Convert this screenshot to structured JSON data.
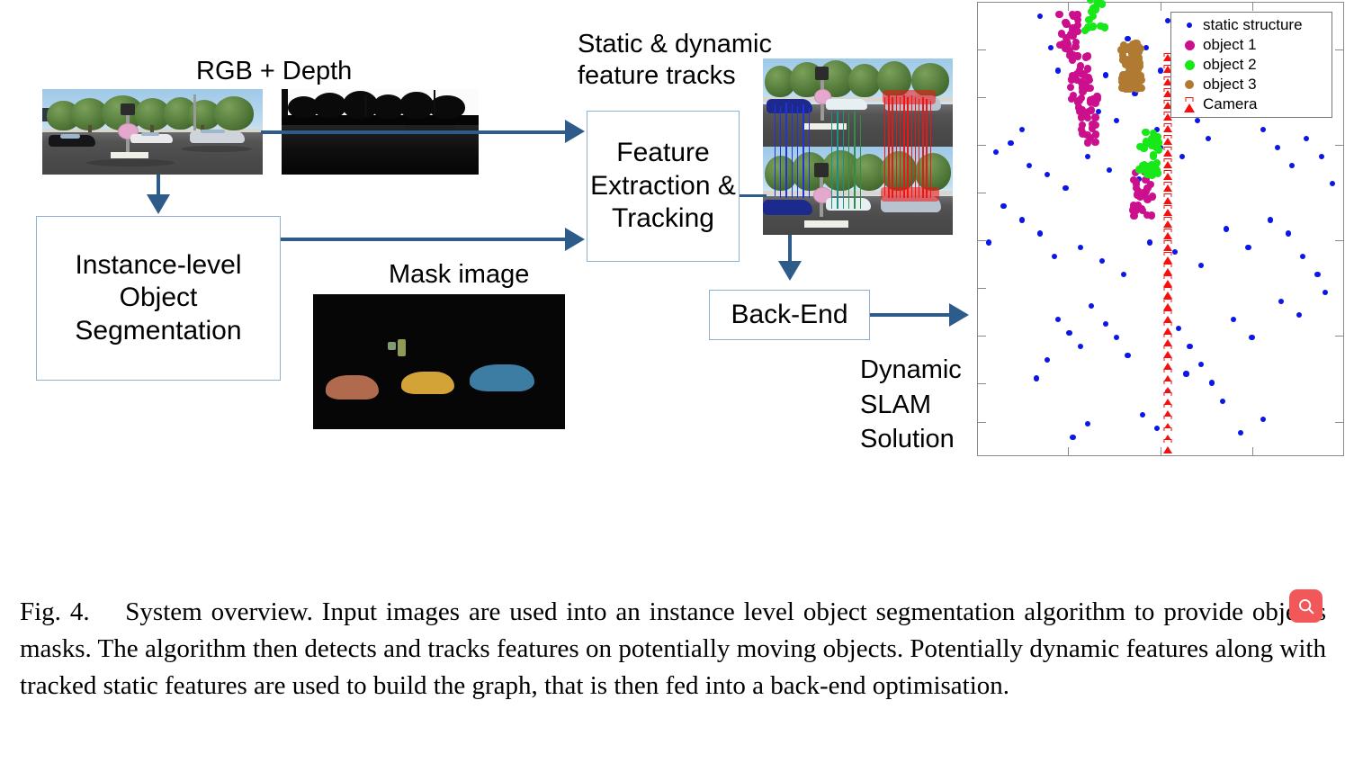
{
  "figure": {
    "labels": {
      "rgb_depth": "RGB + Depth",
      "mask_image": "Mask image",
      "feature_tracks": "Static & dynamic\nfeature tracks",
      "dynamic_slam": "Dynamic\nSLAM\nSolution"
    },
    "boxes": [
      {
        "id": "segmentation",
        "text": "Instance-level\nObject\nSegmentation"
      },
      {
        "id": "feature-extraction",
        "text": "Feature\nExtraction\n& Tracking"
      },
      {
        "id": "back-end",
        "text": "Back-End"
      }
    ],
    "caption": {
      "figure_number": "Fig. 4.",
      "text": "System overview. Input images are used into an instance level object segmentation algorithm to provide objects masks. The algorithm then detects and tracks features on potentially moving objects. Potentially dynamic features along with tracked static features are used to build the graph, that is then fed into a back-end optimisation."
    },
    "colors": {
      "arrow": "#2e5c8a",
      "box_border": "#8fb0cf",
      "static_structure": "#0b16e8",
      "object_1": "#cc0f8c",
      "object_2": "#17e817",
      "object_3": "#b07a33",
      "camera": "#f50f0f",
      "fab": "#f2575a"
    }
  },
  "search_fab": {
    "icon": "search-icon",
    "label": "Search"
  },
  "chart_data": {
    "type": "scatter",
    "title": "Dynamic SLAM Solution",
    "xlabel": "",
    "ylabel": "",
    "grid": false,
    "legend_position": "top-right",
    "legend": [
      {
        "name": "static structure",
        "marker": "dot-small",
        "color": "#0b16e8"
      },
      {
        "name": "object 1",
        "marker": "dot",
        "color": "#cc0f8c"
      },
      {
        "name": "object 2",
        "marker": "dot",
        "color": "#17e817"
      },
      {
        "name": "object 3",
        "marker": "dot",
        "color": "#b07a33"
      },
      {
        "name": "Camera",
        "marker": "camera-frustum",
        "color": "#f50f0f"
      }
    ],
    "axis_ticks": {
      "x_count": 4,
      "y_count": 9,
      "labels_shown": false
    },
    "series": [
      {
        "name": "static structure",
        "color": "#0b16e8",
        "points": [
          [
            0.17,
            0.97
          ],
          [
            0.26,
            0.93
          ],
          [
            0.2,
            0.9
          ],
          [
            0.3,
            0.88
          ],
          [
            0.22,
            0.85
          ],
          [
            0.35,
            0.84
          ],
          [
            0.41,
            0.92
          ],
          [
            0.46,
            0.9
          ],
          [
            0.52,
            0.96
          ],
          [
            0.5,
            0.85
          ],
          [
            0.57,
            0.83
          ],
          [
            0.62,
            0.88
          ],
          [
            0.27,
            0.78
          ],
          [
            0.33,
            0.76
          ],
          [
            0.38,
            0.74
          ],
          [
            0.43,
            0.8
          ],
          [
            0.55,
            0.77
          ],
          [
            0.49,
            0.72
          ],
          [
            0.6,
            0.74
          ],
          [
            0.66,
            0.8
          ],
          [
            0.7,
            0.78
          ],
          [
            0.73,
            0.76
          ],
          [
            0.12,
            0.72
          ],
          [
            0.09,
            0.69
          ],
          [
            0.05,
            0.67
          ],
          [
            0.14,
            0.64
          ],
          [
            0.19,
            0.62
          ],
          [
            0.24,
            0.59
          ],
          [
            0.3,
            0.66
          ],
          [
            0.36,
            0.63
          ],
          [
            0.44,
            0.61
          ],
          [
            0.5,
            0.68
          ],
          [
            0.56,
            0.66
          ],
          [
            0.63,
            0.7
          ],
          [
            0.78,
            0.72
          ],
          [
            0.82,
            0.68
          ],
          [
            0.86,
            0.64
          ],
          [
            0.9,
            0.7
          ],
          [
            0.94,
            0.66
          ],
          [
            0.97,
            0.6
          ],
          [
            0.07,
            0.55
          ],
          [
            0.12,
            0.52
          ],
          [
            0.17,
            0.49
          ],
          [
            0.03,
            0.47
          ],
          [
            0.21,
            0.44
          ],
          [
            0.28,
            0.46
          ],
          [
            0.34,
            0.43
          ],
          [
            0.4,
            0.4
          ],
          [
            0.47,
            0.47
          ],
          [
            0.54,
            0.45
          ],
          [
            0.61,
            0.42
          ],
          [
            0.68,
            0.5
          ],
          [
            0.74,
            0.46
          ],
          [
            0.8,
            0.52
          ],
          [
            0.85,
            0.49
          ],
          [
            0.89,
            0.44
          ],
          [
            0.93,
            0.4
          ],
          [
            0.22,
            0.3
          ],
          [
            0.25,
            0.27
          ],
          [
            0.28,
            0.24
          ],
          [
            0.31,
            0.33
          ],
          [
            0.35,
            0.29
          ],
          [
            0.38,
            0.26
          ],
          [
            0.41,
            0.22
          ],
          [
            0.19,
            0.21
          ],
          [
            0.16,
            0.17
          ],
          [
            0.55,
            0.28
          ],
          [
            0.58,
            0.24
          ],
          [
            0.61,
            0.2
          ],
          [
            0.64,
            0.16
          ],
          [
            0.57,
            0.18
          ],
          [
            0.52,
            0.14
          ],
          [
            0.67,
            0.12
          ],
          [
            0.7,
            0.3
          ],
          [
            0.75,
            0.26
          ],
          [
            0.83,
            0.34
          ],
          [
            0.88,
            0.31
          ],
          [
            0.95,
            0.36
          ],
          [
            0.45,
            0.09
          ],
          [
            0.49,
            0.06
          ],
          [
            0.3,
            0.07
          ],
          [
            0.26,
            0.04
          ],
          [
            0.72,
            0.05
          ],
          [
            0.78,
            0.08
          ]
        ]
      },
      {
        "name": "object 1",
        "color": "#cc0f8c",
        "centroids": [
          [
            0.25,
            0.93
          ],
          [
            0.28,
            0.84
          ],
          [
            0.3,
            0.74
          ],
          [
            0.45,
            0.58
          ]
        ],
        "point_count": 120
      },
      {
        "name": "object 2",
        "color": "#17e817",
        "centroids": [
          [
            0.32,
            0.99
          ],
          [
            0.47,
            0.67
          ]
        ],
        "point_count": 60
      },
      {
        "name": "object 3",
        "color": "#b07a33",
        "centroids": [
          [
            0.42,
            0.86
          ]
        ],
        "point_count": 110
      },
      {
        "name": "Camera",
        "color": "#f50f0f",
        "trajectory_x": 0.52,
        "y_from": 0.02,
        "y_to": 0.88,
        "pose_count": 34
      }
    ]
  }
}
